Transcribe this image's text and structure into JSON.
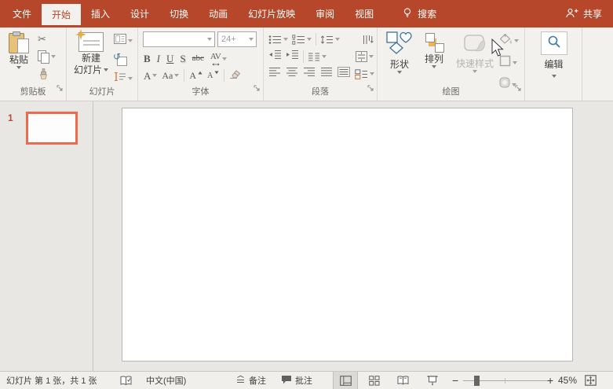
{
  "colors": {
    "accent": "#B7472A",
    "selected_slide_border": "#EC6B4E"
  },
  "titlebar": {
    "tabs": [
      {
        "label": "文件"
      },
      {
        "label": "开始"
      },
      {
        "label": "插入"
      },
      {
        "label": "设计"
      },
      {
        "label": "切换"
      },
      {
        "label": "动画"
      },
      {
        "label": "幻灯片放映"
      },
      {
        "label": "审阅"
      },
      {
        "label": "视图"
      }
    ],
    "search_label": "搜索",
    "share_label": "共享"
  },
  "ribbon": {
    "clipboard": {
      "group_label": "剪贴板",
      "paste_label": "粘贴"
    },
    "slides": {
      "group_label": "幻灯片",
      "new_slide_line1": "新建",
      "new_slide_line2": "幻灯片"
    },
    "font": {
      "group_label": "字体",
      "font_name": "",
      "font_size": "24+",
      "bold": "B",
      "italic": "I",
      "underline": "U",
      "shadow": "S",
      "strikethrough": "abc",
      "char_spacing": "AV",
      "font_color": "A",
      "change_case": "Aa",
      "grow_font": "A",
      "shrink_font": "A"
    },
    "paragraph": {
      "group_label": "段落"
    },
    "drawing": {
      "group_label": "绘图",
      "shapes_label": "形状",
      "arrange_label": "排列",
      "quick_styles_label": "快速样式"
    },
    "editing": {
      "button_label": "编辑"
    }
  },
  "slide_panel": {
    "slide_number": "1"
  },
  "statusbar": {
    "slide_info": "幻灯片 第 1 张，共 1 张",
    "language": "中文(中国)",
    "notes_label": "备注",
    "comments_label": "批注",
    "zoom_level": "45%"
  },
  "icons": {
    "cut": "✂",
    "reset_slide": "↺",
    "zoom_out": "−",
    "zoom_in": "+"
  }
}
